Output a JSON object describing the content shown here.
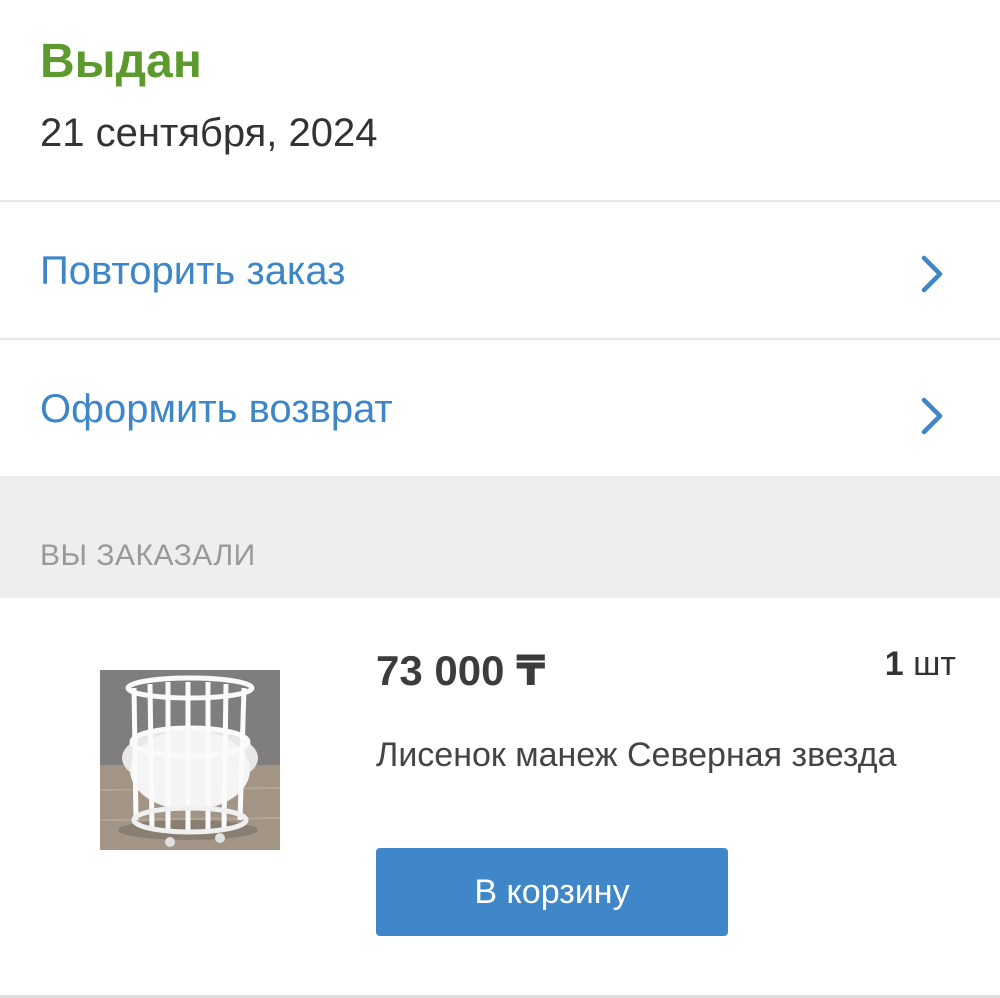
{
  "order": {
    "status": "Выдан",
    "date": "21 сентября, 2024",
    "status_color": "#5c9a2e"
  },
  "actions": [
    {
      "label": "Повторить заказ",
      "icon": "chevron-right-icon"
    },
    {
      "label": "Оформить возврат",
      "icon": "chevron-right-icon"
    }
  ],
  "ordered_section": {
    "title": "ВЫ ЗАКАЗАЛИ",
    "items": [
      {
        "price": "73 000 ₸",
        "quantity_number": "1",
        "quantity_unit": "шт",
        "name": "Лисенок манеж Северная звезда",
        "image": "round-crib-photo",
        "button_label": "В корзину"
      }
    ]
  },
  "colors": {
    "accent": "#3d86c8",
    "button": "#3f87c9",
    "section_bg": "#eeeeee",
    "muted_text": "#999999"
  }
}
